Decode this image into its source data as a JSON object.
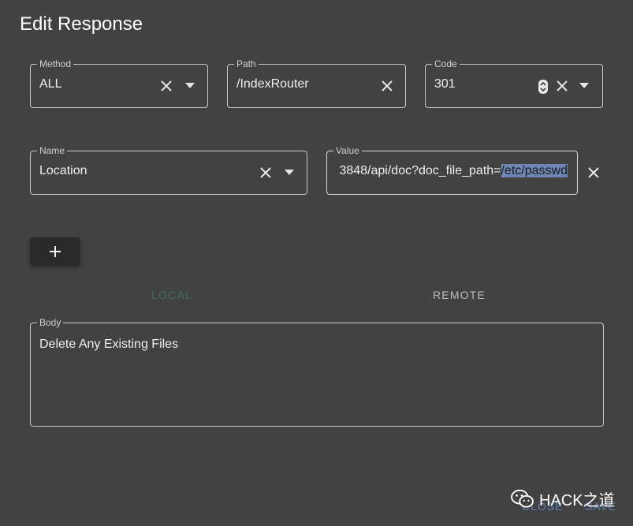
{
  "dialog": {
    "title": "Edit Response"
  },
  "fields": {
    "method": {
      "label": "Method",
      "value": "ALL"
    },
    "path": {
      "label": "Path",
      "value": "/IndexRouter"
    },
    "code": {
      "label": "Code",
      "value": "301"
    },
    "name": {
      "label": "Name",
      "value": "Location"
    },
    "value": {
      "label": "Value",
      "visible_prefix": "3848/api/doc?doc_file_path=",
      "selected_text": "/etc/passwd"
    }
  },
  "add_button": {
    "icon": "plus-icon"
  },
  "tabs": [
    {
      "label": "LOCAL",
      "active": true
    },
    {
      "label": "REMOTE",
      "active": false
    }
  ],
  "body": {
    "label": "Body",
    "value": "Delete Any Existing Files"
  },
  "footer": {
    "close_label": "CLOSE",
    "save_label": "SAVE"
  },
  "watermark": {
    "text": "HACK之道",
    "icon": "wechat-icon"
  },
  "colors": {
    "background": "#424242",
    "accent_local": "#3f6f62",
    "footer_text": "#5f7fb5",
    "selection": "#6e86b3"
  }
}
